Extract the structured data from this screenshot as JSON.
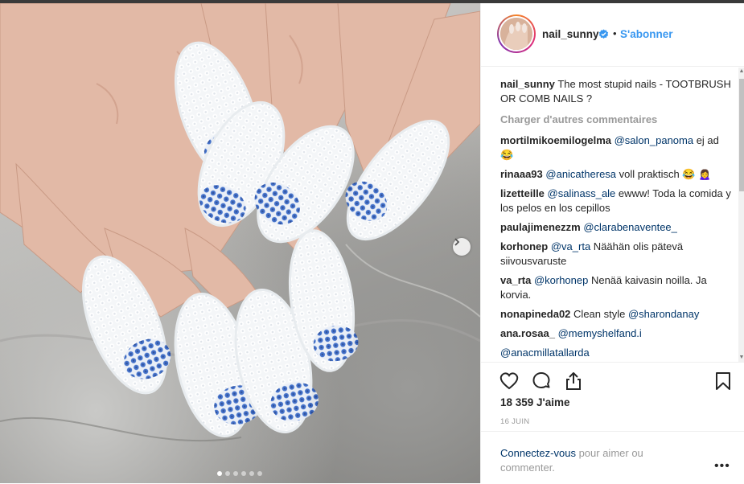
{
  "post": {
    "username": "nail_sunny",
    "separator": "•",
    "follow_label": "S'abonner",
    "caption_user": "nail_sunny",
    "caption_text": "The most stupid nails - TOOTBRUSH OR COMB NAILS ?",
    "load_more_label": "Charger d'autres commentaires",
    "likes": "18 359 J'aime",
    "date": "16 JUIN",
    "login_link": "Connectez-vous",
    "login_rest": " pour aimer ou commenter.",
    "more_label": "•••",
    "carousel": {
      "count": 6,
      "active_index": 0
    }
  },
  "comments": [
    {
      "user": "mortilmikoemilogelma",
      "mention": "@salon_panoma",
      "text": " ej ad 😂"
    },
    {
      "user": "rinaaa93",
      "mention": "@anicatheresa",
      "text": " voll praktisch 😂 🙍‍♀️"
    },
    {
      "user": "lizetteille",
      "mention": "@salinass_ale",
      "text": " ewww! Toda la comida y los pelos en los cepillos"
    },
    {
      "user": "paulajimenezzm",
      "mention": "@clarabenaventee_",
      "text": ""
    },
    {
      "user": "korhonep",
      "mention": "@va_rta",
      "text": " Näähän olis pätevä siivousvaruste"
    },
    {
      "user": "va_rta",
      "mention": "@korhonep",
      "text": " Nenää kaivasin noilla. Ja korvia."
    },
    {
      "user": "nonapineda02",
      "mention": "",
      "text": "Clean style ",
      "mention_after": "@sharondanay"
    },
    {
      "user": "ana.rosaa_",
      "mention": "@memyshelfand.i",
      "text": ""
    },
    {
      "user": "",
      "mention": "@anacmillatallarda",
      "text": ""
    }
  ],
  "icons": {
    "verified": "verified-badge-icon",
    "like": "heart-icon",
    "comment": "comment-bubble-icon",
    "share": "share-icon",
    "save": "bookmark-icon",
    "next": "chevron-right-icon"
  },
  "colors": {
    "accent": "#3897f0",
    "mention": "#003569",
    "muted": "#999999",
    "bristle_blue": "#2f62c4"
  }
}
